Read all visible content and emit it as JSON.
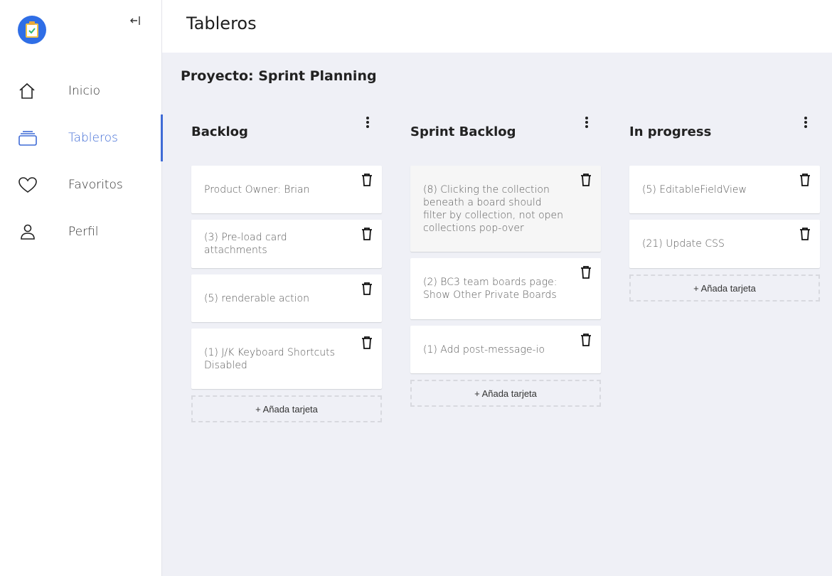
{
  "app": {
    "title": "Tableros"
  },
  "sidebar": {
    "collapse_icon": "collapse-left-icon",
    "items": [
      {
        "label": "Inicio",
        "icon": "home-icon",
        "active": false
      },
      {
        "label": "Tableros",
        "icon": "boards-icon",
        "active": true
      },
      {
        "label": "Favoritos",
        "icon": "heart-icon",
        "active": false
      },
      {
        "label": "Perfil",
        "icon": "user-icon",
        "active": false
      }
    ]
  },
  "colors": {
    "accent": "#3f6bd6",
    "logo_bg": "#2f6ee6",
    "page_bg": "#eff0f6"
  },
  "project": {
    "title": "Proyecto: Sprint Planning"
  },
  "columns": [
    {
      "title": "Backlog",
      "add_label": "+ Añada tarjeta",
      "cards": [
        {
          "text": "Product Owner: Brian"
        },
        {
          "text": "(3) Pre-load card attachments"
        },
        {
          "text": "(5) renderable action"
        },
        {
          "text": "(1) J/K Keyboard Shortcuts Disabled"
        }
      ]
    },
    {
      "title": "Sprint Backlog",
      "add_label": "+ Añada tarjeta",
      "cards": [
        {
          "text": "(8) Clicking the collection beneath a board should filter by collection, not open collections pop-over"
        },
        {
          "text": "(2) BC3 team boards page: Show Other Private Boards"
        },
        {
          "text": "(1) Add post-message-io"
        }
      ]
    },
    {
      "title": "In progress",
      "add_label": "+ Añada tarjeta",
      "cards": [
        {
          "text": "(5) EditableFieldView"
        },
        {
          "text": "(21) Update CSS"
        }
      ]
    }
  ]
}
